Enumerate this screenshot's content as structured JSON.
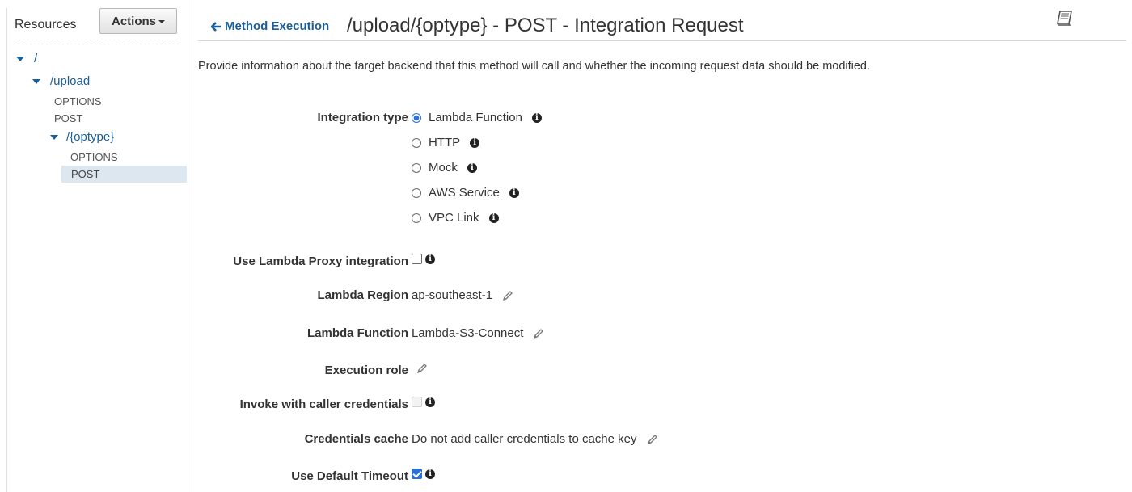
{
  "sidebar": {
    "title": "Resources",
    "actions_label": "Actions",
    "tree": [
      {
        "label": "/"
      },
      {
        "label": "/upload"
      },
      {
        "label": "OPTIONS"
      },
      {
        "label": "POST"
      },
      {
        "label": "/{optype}"
      },
      {
        "label": "OPTIONS"
      },
      {
        "label": "POST",
        "selected": true
      }
    ]
  },
  "header": {
    "back_label": "Method Execution",
    "title": "/upload/{optype} - POST - Integration Request"
  },
  "description": "Provide information about the target backend that this method will call and whether the incoming request data should be modified.",
  "form": {
    "integration_type": {
      "label": "Integration type",
      "options": [
        "Lambda Function",
        "HTTP",
        "Mock",
        "AWS Service",
        "VPC Link"
      ],
      "selected": "Lambda Function"
    },
    "lambda_proxy": {
      "label": "Use Lambda Proxy integration",
      "checked": false
    },
    "lambda_region": {
      "label": "Lambda Region",
      "value": "ap-southeast-1"
    },
    "lambda_function": {
      "label": "Lambda Function",
      "value": "Lambda-S3-Connect"
    },
    "execution_role": {
      "label": "Execution role",
      "value": ""
    },
    "invoke_caller": {
      "label": "Invoke with caller credentials",
      "checked": false,
      "disabled": true
    },
    "credentials_cache": {
      "label": "Credentials cache",
      "value": "Do not add caller credentials to cache key"
    },
    "default_timeout": {
      "label": "Use Default Timeout",
      "checked": true
    }
  },
  "colors": {
    "link": "#1a5e9a",
    "accent": "#2b6fd6",
    "selected_bg": "#dde7ef"
  }
}
